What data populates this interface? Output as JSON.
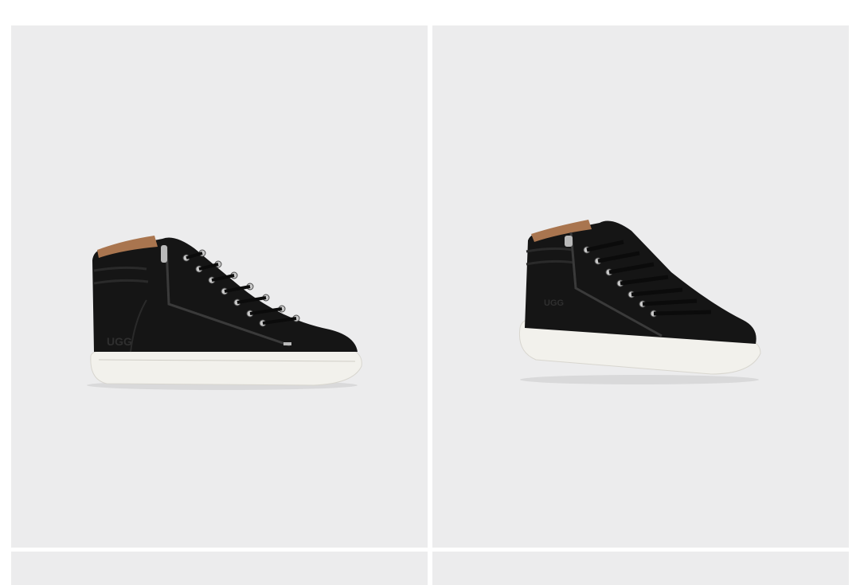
{
  "grid": {
    "tiles": [
      {
        "name": "product-tile-1",
        "brand_mark": "UGG"
      },
      {
        "name": "product-tile-2",
        "brand_mark": "UGG"
      },
      {
        "name": "product-tile-3"
      },
      {
        "name": "product-tile-4"
      }
    ]
  },
  "colors": {
    "page_background": "#ffffff",
    "tile_background": "#ececed",
    "shoe_leather": "#151515",
    "sole": "#f2f1ec",
    "lining": "#a9754f",
    "eyelet": "#c9c9c9"
  }
}
